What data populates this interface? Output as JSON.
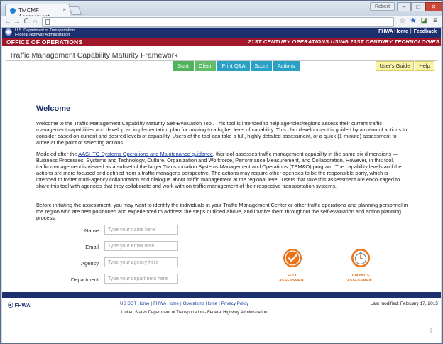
{
  "browser": {
    "tab_title": "TMCMF Assessment",
    "tab_close": "×",
    "profile_name": "Robert",
    "window_buttons": {
      "minimize": "–",
      "maximize": "□",
      "close": "✕"
    },
    "nav": {
      "back": "←",
      "forward": "→",
      "reload": "C",
      "home": "⌂"
    },
    "address": "",
    "toolbar_icons": {
      "bookmark": "☆",
      "star_ext": "★",
      "ext2": "◪",
      "menu": "≡"
    }
  },
  "site": {
    "gov_line1": "U.S. Department of Transportation",
    "gov_line2": "Federal Highway Administration",
    "top_links": [
      "FHWA Home",
      "Feedback"
    ],
    "top_link_separator": "|",
    "office": "OFFICE OF OPERATIONS",
    "ops_tagline": "21ST CENTURY OPERATIONS USING 21ST CENTURY TECHNOLOGIES"
  },
  "app": {
    "title": "Traffic Management Capability Maturity Framework",
    "buttons": {
      "start": "Start",
      "clear": "Clear",
      "print": "Print Q&A",
      "score": "Score",
      "actions": "Actions",
      "users_guide": "User's Guide",
      "help": "Help"
    }
  },
  "main": {
    "heading": "Welcome",
    "para1": "Welcome to the Traffic Management Capability Maturity Self-Evaluation Tool. This tool is intended to help agencies/regions assess their current traffic management capabilities and develop an implementation plan for moving to a higher level of capability. This plan development is guided by a menu of actions to consider based on current and desired levels of capability. Users of the tool can take a full, highly detailed assessment, or a quick (1-minute) assessment to arrive at the point of selecting actions.",
    "para2_pre": "Modeled after the ",
    "para2_link": "AASHTO Systems Operations and Maintenance guidance",
    "para2_post": ", this tool assesses traffic management capability in the same six dimensions — Business Processes, Systems and Technology, Culture, Organization and Workforce, Performance Measurement, and Collaboration. However, in this tool, traffic management is viewed as a subset of the larger Transportation Systems Management and Operations (TSM&O) program. The capability levels and the actions are more focused and defined from a traffic manager's perspective. The actions may require other agencies to be the responsible party, which is intended to foster multi-agency collaboration and dialogue about traffic management at the regional level. Users that take this assessment are encouraged to share this tool with agencies that they collaborate and work with on traffic management of their respective transportation systems.",
    "para3": "Before initiating the assessment, you may want to identify the individuals in your Traffic Management Center or other traffic operations and planning personnel in the region who are best positioned and experienced to address the steps outlined above, and involve them throughout the self-evaluation and action planning process."
  },
  "form": {
    "name_label": "Name",
    "name_placeholder": "Type your name here",
    "email_label": "Email",
    "email_placeholder": "Type your email here",
    "agency_label": "Agency",
    "agency_placeholder": "Type your agency here",
    "department_label": "Department",
    "department_placeholder": "Type your department here"
  },
  "assessments": {
    "full_line1": "FULL",
    "full_line2": "ASSESSMENT",
    "quick_line1": "1-MINUTE",
    "quick_line2": "ASSESSMENT",
    "accent_color": "#e8731a"
  },
  "footer": {
    "logo": "FHWA",
    "links": [
      "US DOT Home",
      "FHWA Home",
      "Operations Home",
      "Privacy Policy"
    ],
    "separator": "|",
    "last_modified": "Last modified: February 17, 2015",
    "dept": "United States Department of Transportation - Federal Highway Administration"
  },
  "colors": {
    "navy": "#1c2f6e",
    "maroon": "#a0172a",
    "green": "#53b25c",
    "teal": "#2aa1c4",
    "yellow": "#fbf3a6"
  }
}
